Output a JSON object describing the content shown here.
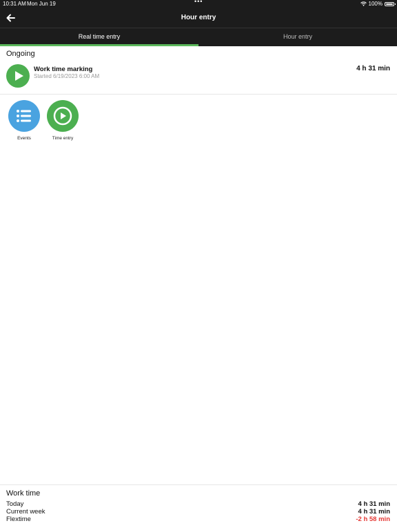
{
  "status_bar": {
    "time": "10:31 AM",
    "date": "Mon Jun 19",
    "dots": "•••",
    "battery_text": "100%"
  },
  "navbar": {
    "title": "Hour entry",
    "back_icon": "arrow-left-icon"
  },
  "tabs": [
    {
      "label": "Real time entry",
      "active": true
    },
    {
      "label": "Hour entry",
      "active": false
    }
  ],
  "colors": {
    "bar_bg": "#1c1c1c",
    "accent_green": "#4caf50",
    "events_blue": "#4aa3e0",
    "negative_red": "#e53935"
  },
  "ongoing": {
    "section_title": "Ongoing",
    "item": {
      "title": "Work time marking",
      "subtitle": "Started 6/19/2023 6:00 AM",
      "duration": "4 h 31 min",
      "icon": "play-icon"
    }
  },
  "actions": [
    {
      "label": "Events",
      "icon": "list-icon"
    },
    {
      "label": "Time entry",
      "icon": "play-icon"
    }
  ],
  "work_time": {
    "title": "Work time",
    "rows": [
      {
        "label": "Today",
        "value": "4 h 31 min"
      },
      {
        "label": "Current week",
        "value": "4 h 31 min"
      },
      {
        "label": "Flextime",
        "value": "-2 h 58 min"
      }
    ]
  }
}
